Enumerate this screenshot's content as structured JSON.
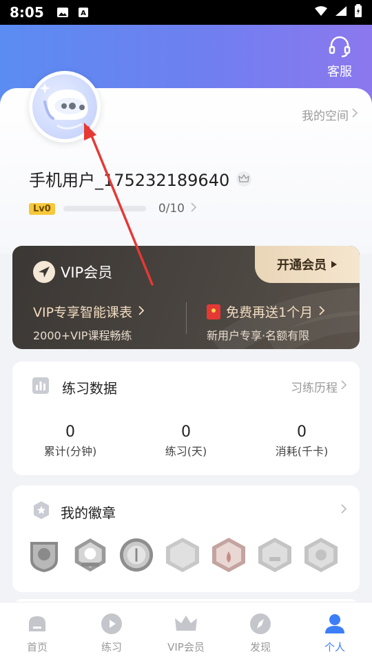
{
  "status_bar": {
    "time": "8:05"
  },
  "header": {
    "service_label": "客服"
  },
  "profile": {
    "my_space": "我的空间",
    "username": "手机用户_175232189640",
    "level_badge": "Lv0",
    "level_progress": "0/10",
    "level_fraction": 0
  },
  "vip": {
    "title": "VIP会员",
    "open_button": "开通会员",
    "left_line1": "VIP专享智能课表",
    "left_line2": "2000+VIP课程畅练",
    "right_line1": "免费再送1个月",
    "right_line2": "新用户专享·名额有限"
  },
  "practice": {
    "title": "练习数据",
    "link": "习练历程",
    "stats": [
      {
        "value": "0",
        "label": "累计(分钟)"
      },
      {
        "value": "0",
        "label": "练习(天)"
      },
      {
        "value": "0",
        "label": "消耗(千卡)"
      }
    ]
  },
  "badges": {
    "title": "我的徽章"
  },
  "nav": {
    "items": [
      {
        "label": "首页"
      },
      {
        "label": "练习"
      },
      {
        "label": "VIP会员"
      },
      {
        "label": "发现"
      },
      {
        "label": "个人"
      }
    ]
  },
  "colors": {
    "accent": "#3c7ef7",
    "header_start": "#5b8cf1",
    "header_end": "#8c78ee",
    "annotation_arrow": "#e53935"
  }
}
